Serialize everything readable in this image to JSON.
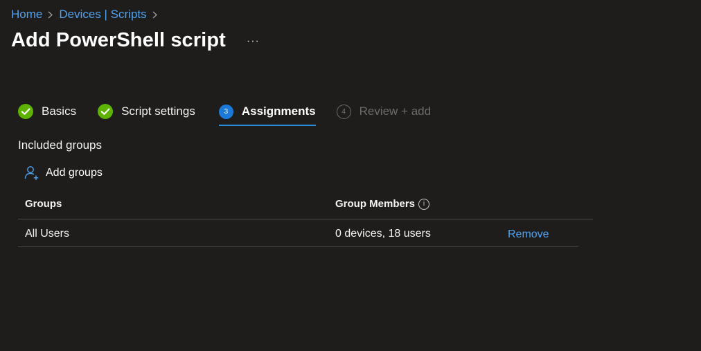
{
  "breadcrumb": {
    "items": [
      "Home",
      "Devices | Scripts"
    ]
  },
  "header": {
    "title": "Add PowerShell script",
    "more": "···"
  },
  "wizard": {
    "steps": [
      {
        "label": "Basics",
        "state": "done"
      },
      {
        "label": "Script settings",
        "state": "done"
      },
      {
        "label": "Assignments",
        "number": "3",
        "state": "current"
      },
      {
        "label": "Review + add",
        "number": "4",
        "state": "future"
      }
    ]
  },
  "included_groups": {
    "label": "Included groups",
    "add_label": "Add groups",
    "table": {
      "columns": [
        "Groups",
        "Group Members"
      ],
      "rows": [
        {
          "group": "All Users",
          "members": "0 devices, 18 users",
          "action": "Remove"
        }
      ]
    }
  },
  "colors": {
    "background": "#1e1d1c",
    "link": "#4fa3f0",
    "accent": "#1b7ad8",
    "success": "#5db300"
  }
}
